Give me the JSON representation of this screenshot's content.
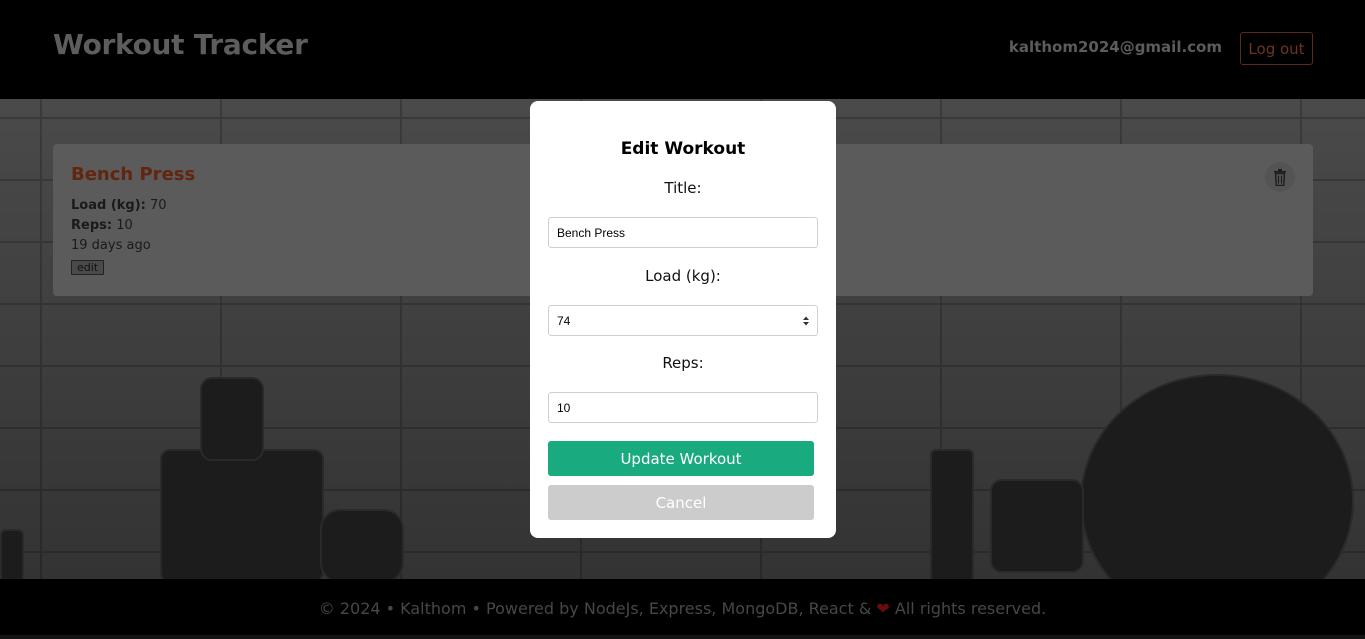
{
  "header": {
    "brand": "Workout Tracker",
    "user_email": "kalthom2024@gmail.com",
    "logout_label": "Log out"
  },
  "workouts": [
    {
      "title": "Bench Press",
      "load_label": "Load (kg):",
      "load_value": "70",
      "reps_label": "Reps:",
      "reps_value": "10",
      "age": "19 days ago",
      "edit_label": "edit"
    }
  ],
  "modal": {
    "title": "Edit Workout",
    "title_label": "Title:",
    "title_value": "Bench Press",
    "load_label": "Load (kg):",
    "load_value": "74",
    "reps_label": "Reps:",
    "reps_value": "10",
    "update_label": "Update Workout",
    "cancel_label": "Cancel"
  },
  "footer": {
    "text_before": "© 2024 • Kalthom • Powered by NodeJs, Express, MongoDB, React &",
    "heart_icon": "heart-icon",
    "text_after": "All rights reserved."
  },
  "colors": {
    "accent": "#1aaa80",
    "brand_title": "#62250f",
    "cancel": "#cccccc"
  }
}
